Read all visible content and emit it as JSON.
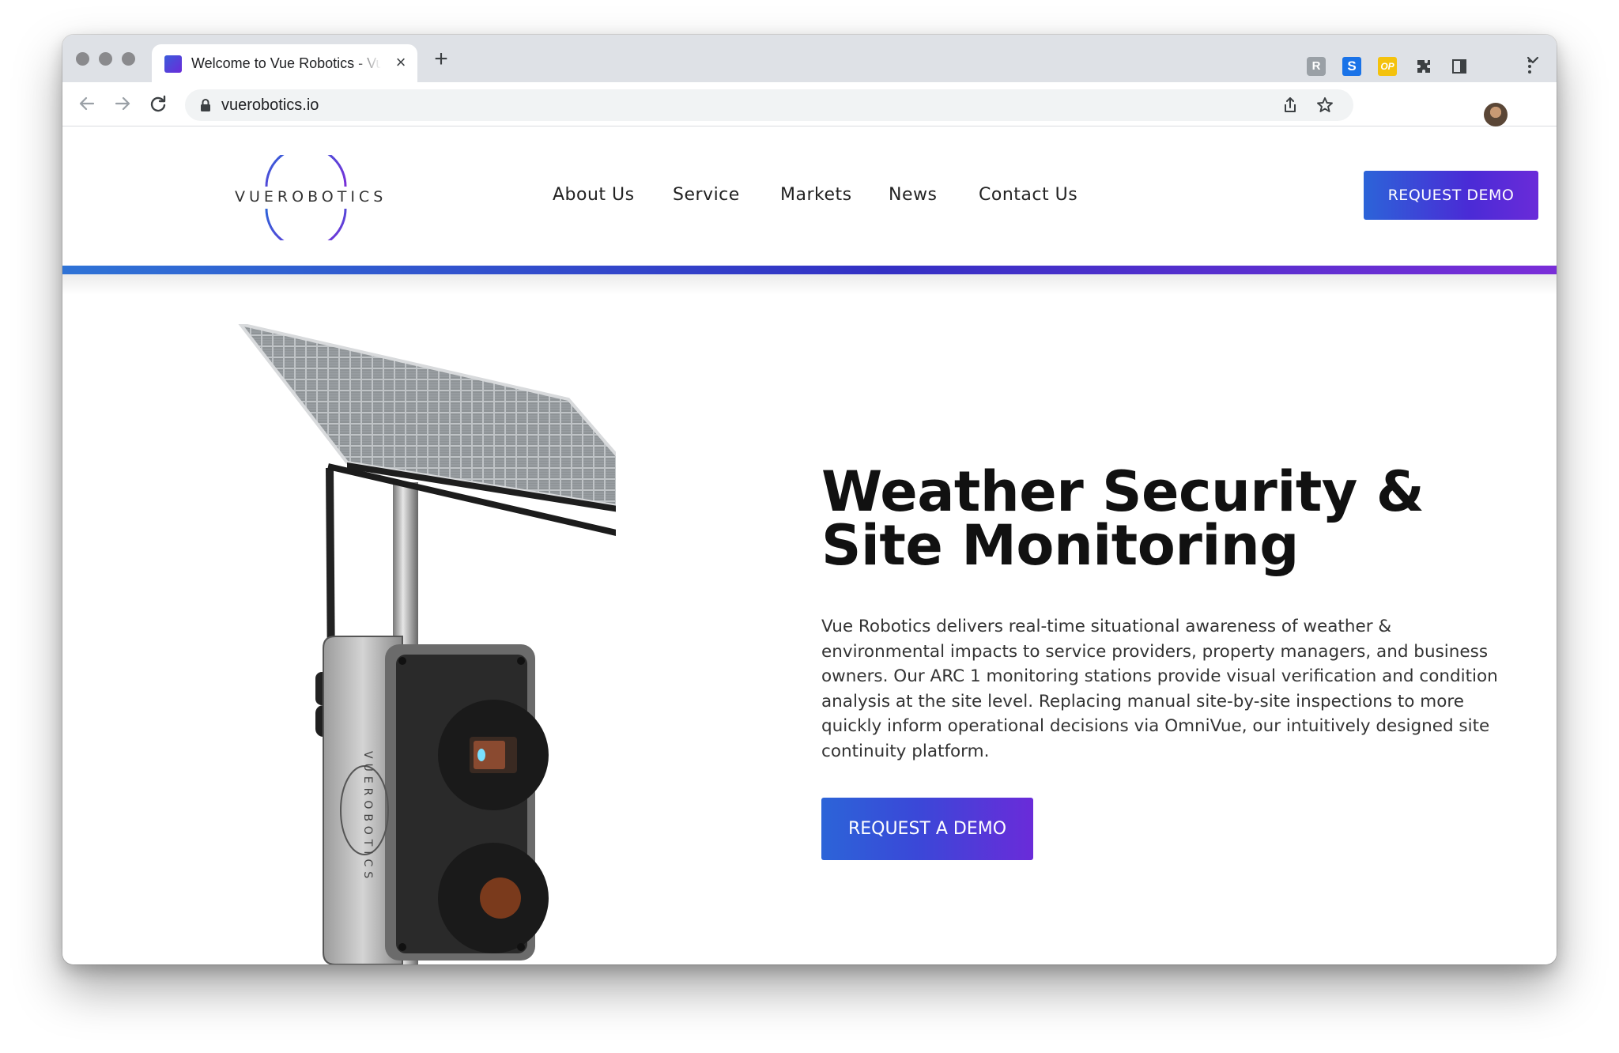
{
  "browser": {
    "tab_title": "Welcome to Vue Robotics - Vue Robotics",
    "url": "vuerobotics.io"
  },
  "site": {
    "logo_text": "VUEROBOTICS",
    "nav": [
      "About Us",
      "Service",
      "Markets",
      "News",
      "Contact Us"
    ],
    "header_cta": "REQUEST DEMO"
  },
  "hero": {
    "title": "Weather Security & Site Monitoring",
    "text": "Vue Robotics delivers real-time situational awareness of weather & environmental impacts to service providers, property managers, and business owners. Our ARC 1 monitoring stations provide visual verification and condition analysis at the site level. Replacing manual site-by-site inspections to more quickly inform operational decisions via OmniVue, our intuitively designed site continuity platform.",
    "cta": "REQUEST A DEMO",
    "product_label": "VUEROBOTICS"
  },
  "colors": {
    "brand_blue": "#2c64d8",
    "brand_purple": "#6a2bd9"
  },
  "icons": {
    "back": "arrow-left-icon",
    "forward": "arrow-right-icon",
    "reload": "reload-icon",
    "lock": "lock-icon",
    "share": "share-icon",
    "bookmark": "star-icon",
    "extensions": "puzzle-icon",
    "side_panel": "side-panel-icon",
    "menu": "kebab-menu-icon"
  }
}
